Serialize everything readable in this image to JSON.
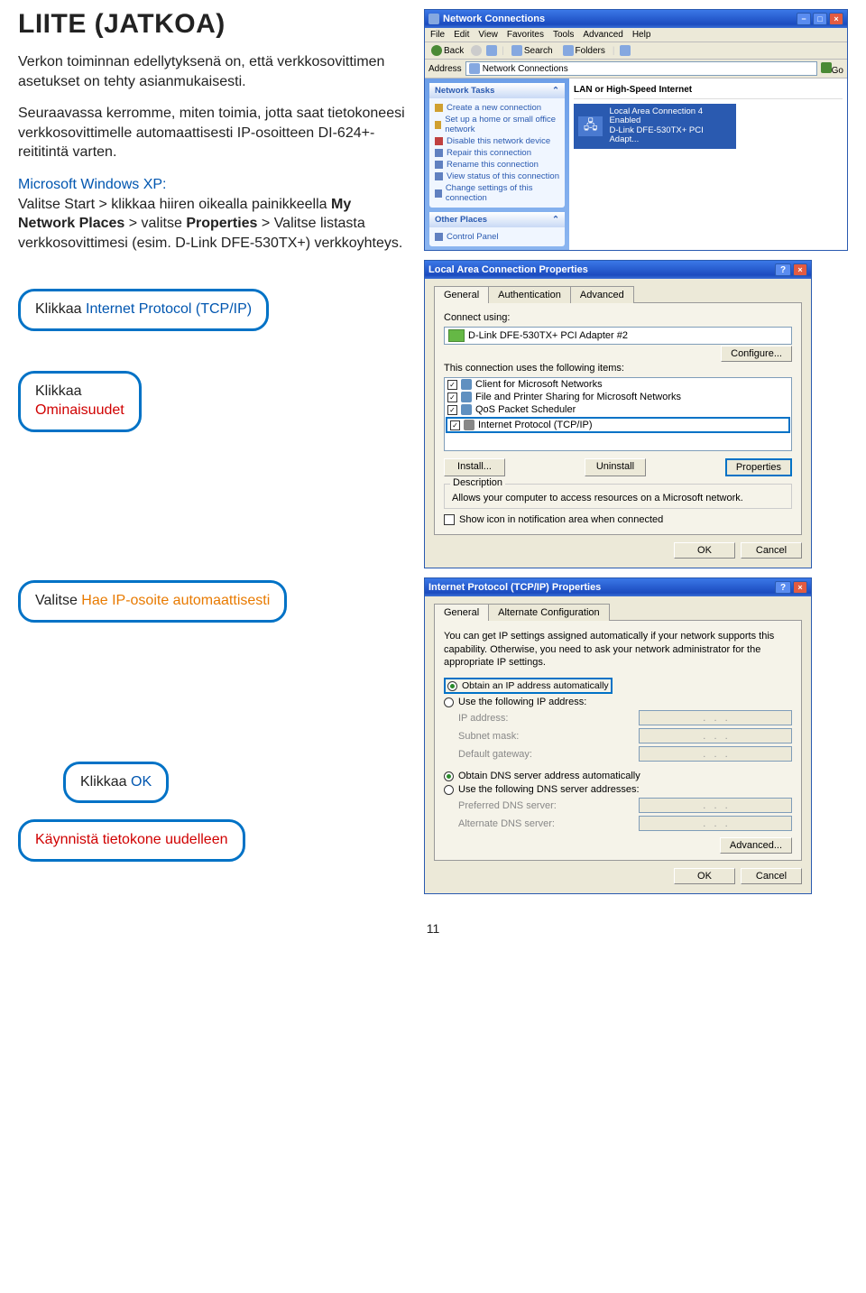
{
  "title": "LIITE (JATKOA)",
  "intro": {
    "p1": "Verkon toiminnan edellytyksenä on, että verkkosovittimen asetukset on tehty asianmukaisesti.",
    "p2": "Seuraavassa kerromme, miten toimia, jotta saat tietokoneesi verkkosovittimelle automaattisesti IP-osoitteen DI-624+-reititintä varten.",
    "xp_label": "Microsoft Windows XP:",
    "xp_steps_1": "Valitse Start > klikkaa hiiren oikealla painikkeella ",
    "xp_steps_bold1": "My Network Places",
    "xp_steps_2": " > valitse ",
    "xp_steps_bold2": "Properties",
    "xp_steps_3": " > Valitse listasta verkkosovittimesi (esim. D-Link DFE-530TX+) verkkoyhteys."
  },
  "callouts": {
    "c1_a": "Klikkaa ",
    "c1_b": "Internet Protocol (TCP/IP)",
    "c2_a": "Klikkaa",
    "c2_b": "Ominaisuudet",
    "c3_a": "Valitse ",
    "c3_b": "Hae IP-osoite automaattisesti",
    "c4_a": "Klikkaa ",
    "c4_b": "OK",
    "c5_a": "Käynnistä tietokone uudelleen"
  },
  "nc": {
    "title": "Network Connections",
    "menu": [
      "File",
      "Edit",
      "View",
      "Favorites",
      "Tools",
      "Advanced",
      "Help"
    ],
    "back": "Back",
    "search": "Search",
    "folders": "Folders",
    "address_label": "Address",
    "address_value": "Network Connections",
    "go": "Go",
    "tasks_hd": "Network Tasks",
    "tasks": [
      "Create a new connection",
      "Set up a home or small office network",
      "Disable this network device",
      "Repair this connection",
      "Rename this connection",
      "View status of this connection",
      "Change settings of this connection"
    ],
    "other_hd": "Other Places",
    "cp": "Control Panel",
    "section": "LAN or High-Speed Internet",
    "item_name": "Local Area Connection 4",
    "item_status": "Enabled",
    "item_device": "D-Link DFE-530TX+ PCI Adapt..."
  },
  "lac": {
    "title": "Local Area Connection Properties",
    "tabs": [
      "General",
      "Authentication",
      "Advanced"
    ],
    "connect_using": "Connect using:",
    "adapter": "D-Link DFE-530TX+ PCI Adapter #2",
    "configure": "Configure...",
    "uses_items": "This connection uses the following items:",
    "items": [
      "Client for Microsoft Networks",
      "File and Printer Sharing for Microsoft Networks",
      "QoS Packet Scheduler",
      "Internet Protocol (TCP/IP)"
    ],
    "install": "Install...",
    "uninstall": "Uninstall",
    "properties": "Properties",
    "desc_hd": "Description",
    "desc_body": "Allows your computer to access resources on a Microsoft network.",
    "show_icon": "Show icon in notification area when connected",
    "ok": "OK",
    "cancel": "Cancel"
  },
  "tcp": {
    "title": "Internet Protocol (TCP/IP) Properties",
    "tabs": [
      "General",
      "Alternate Configuration"
    ],
    "blurb": "You can get IP settings assigned automatically if your network supports this capability. Otherwise, you need to ask your network administrator for the appropriate IP settings.",
    "obtain_ip": "Obtain an IP address automatically",
    "use_ip": "Use the following IP address:",
    "ip_addr": "IP address:",
    "subnet": "Subnet mask:",
    "gateway": "Default gateway:",
    "obtain_dns": "Obtain DNS server address automatically",
    "use_dns": "Use the following DNS server addresses:",
    "pref_dns": "Preferred DNS server:",
    "alt_dns": "Alternate DNS server:",
    "advanced": "Advanced...",
    "ok": "OK",
    "cancel": "Cancel"
  },
  "page_number": "11"
}
